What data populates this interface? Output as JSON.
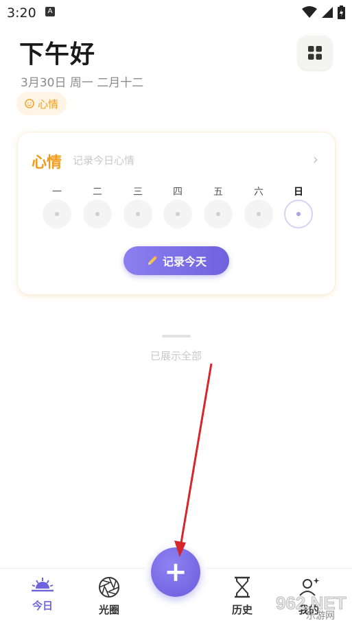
{
  "status_bar": {
    "time": "3:20",
    "notification_glyph": "A"
  },
  "header": {
    "greeting": "下午好",
    "date": "3月30日 周一  二月十二",
    "mood_chip": "心情"
  },
  "mood_card": {
    "title": "心情",
    "subtitle": "记录今日心情",
    "days": [
      {
        "label": "一",
        "today": false
      },
      {
        "label": "二",
        "today": false
      },
      {
        "label": "三",
        "today": false
      },
      {
        "label": "四",
        "today": false
      },
      {
        "label": "五",
        "today": false
      },
      {
        "label": "六",
        "today": false
      },
      {
        "label": "日",
        "today": true
      }
    ],
    "record_button": "记录今天"
  },
  "list_end_text": "已展示全部",
  "bottom_nav": {
    "items": [
      {
        "label": "今日",
        "icon": "sunrise-icon",
        "active": true
      },
      {
        "label": "光圈",
        "icon": "aperture-icon",
        "active": false
      },
      {
        "label": "历史",
        "icon": "hourglass-icon",
        "active": false
      },
      {
        "label": "我的",
        "icon": "user-sparkle-icon",
        "active": false
      }
    ],
    "fab_label": "+"
  },
  "watermark": {
    "text": "962.NET",
    "subtext": "乐游网"
  },
  "colors": {
    "accent": "#6f62dd",
    "mood_orange": "#f39a1b",
    "arrow": "#d6262b"
  }
}
